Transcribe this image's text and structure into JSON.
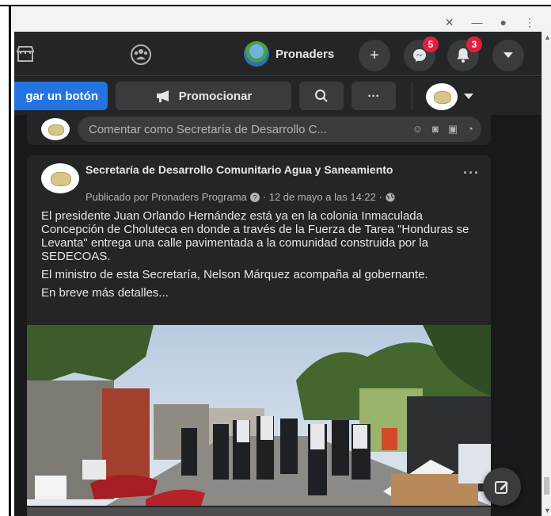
{
  "topnav": {
    "page_name": "Pronaders",
    "messenger_badge": "5",
    "notifications_badge": "3",
    "create_icon": "plus-icon",
    "menu_icon": "caret-down-icon"
  },
  "actionbar": {
    "add_button_label": "gar un botón",
    "promote_label": "Promocionar",
    "search_icon": "search-icon",
    "more_label": "···"
  },
  "comment": {
    "placeholder": "Comentar como Secretaría de Desarrollo C..."
  },
  "post": {
    "author": "Secretaría de Desarrollo Comunitario Agua y Saneamiento",
    "meta_prefix": "Publicado por Pronaders Programa",
    "meta_date": "· 12 de mayo a las 14:22 ·",
    "more": "···",
    "paragraphs": [
      "El presidente Juan Orlando Hernández está ya en la colonia Inmaculada Concepción de Choluteca en donde a través de la Fuerza de Tarea \"Honduras se Levanta\" entrega una calle pavimentada a la comunidad construida por la SEDECOAS.",
      "El ministro de esta Secretaría, Nelson Márquez acompaña al gobernante.",
      "En breve más detalles..."
    ]
  },
  "colors": {
    "background": "#18191a",
    "card": "#242526",
    "accent": "#2374e1",
    "badge": "#e41e3f"
  }
}
